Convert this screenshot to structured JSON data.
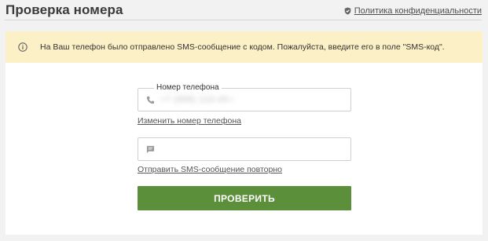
{
  "header": {
    "title": "Проверка номера",
    "privacy_link": "Политика конфиденциальности",
    "privacy_icon": "shield-check-icon"
  },
  "notice": {
    "icon": "info-icon",
    "text": "На Ваш телефон было отправлено SMS-сообщение с кодом. Пожалуйста, введите его в поле \"SMS-код\".",
    "background": "#fcf0c6"
  },
  "form": {
    "phone_field": {
      "label": "Номер телефона",
      "icon": "phone-icon",
      "value": "+7 (999) 123-45-67"
    },
    "change_phone_link": "Изменить номер телефона",
    "sms_field": {
      "icon": "message-icon",
      "value": ""
    },
    "resend_link": "Отправить SMS-сообщение повторно",
    "submit_label": "ПРОВЕРИТЬ",
    "submit_color": "#5b8f3a"
  }
}
